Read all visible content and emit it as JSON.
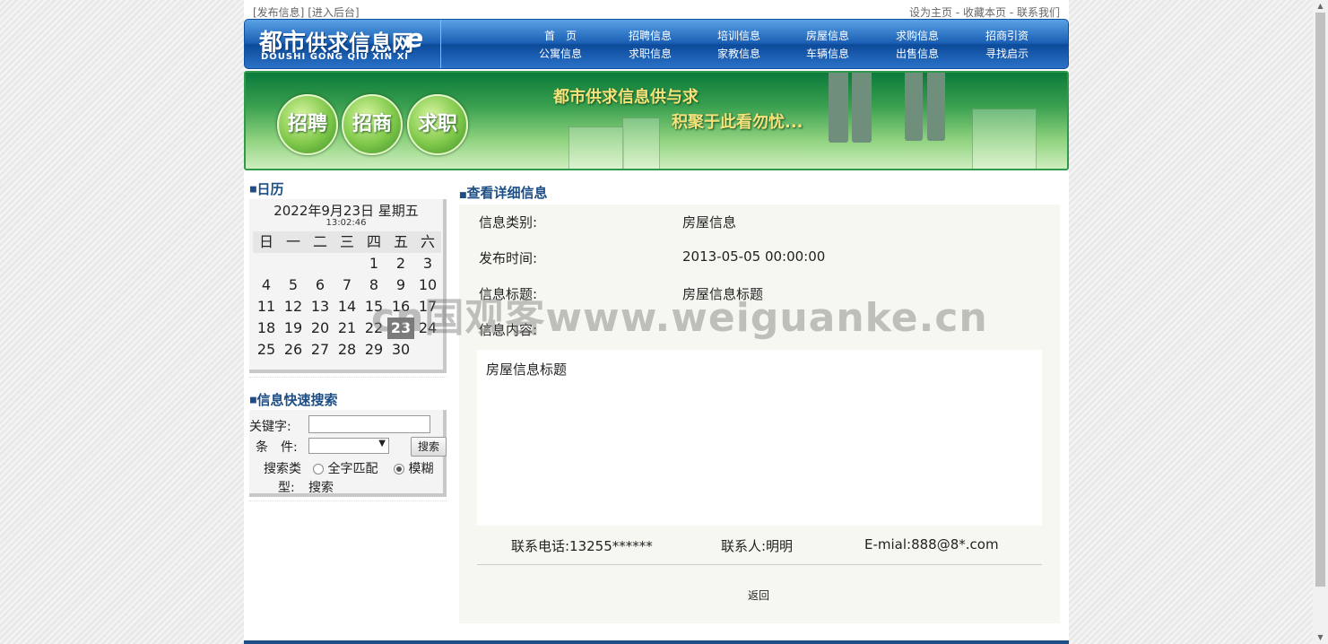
{
  "toplinks": {
    "publish": "[发布信息]",
    "admin": "[进入后台]",
    "sethome": "设为主页",
    "dash1": " - ",
    "bookmark": "收藏本页",
    "dash2": " - ",
    "contact": "联系我们"
  },
  "logo": {
    "cn_part1": "都市",
    "cn_part2": "供求信息网",
    "e": "e",
    "en": "DOUSHI  GONG QIU XIN XI"
  },
  "nav": {
    "row1": [
      "首　页",
      "招聘信息",
      "培训信息",
      "房屋信息",
      "求购信息",
      "招商引资"
    ],
    "row2": [
      "公寓信息",
      "求职信息",
      "家教信息",
      "车辆信息",
      "出售信息",
      "寻找启示"
    ]
  },
  "banner": {
    "buttons": [
      "招聘",
      "招商",
      "求职"
    ],
    "slogan1": "都市供求信息供与求",
    "slogan2": "积聚于此看勿忧..."
  },
  "sidebar": {
    "calendar_title": "日历",
    "date_line": "2022年9月23日 星期五",
    "time": "13:02:46",
    "weekdays": [
      "日",
      "一",
      "二",
      "三",
      "四",
      "五",
      "六"
    ],
    "weeks": [
      [
        "",
        "",
        "",
        "",
        "1",
        "2",
        "3"
      ],
      [
        "4",
        "5",
        "6",
        "7",
        "8",
        "9",
        "10"
      ],
      [
        "11",
        "12",
        "13",
        "14",
        "15",
        "16",
        "17"
      ],
      [
        "18",
        "19",
        "20",
        "21",
        "22",
        "23",
        "24"
      ],
      [
        "25",
        "26",
        "27",
        "28",
        "29",
        "30",
        ""
      ]
    ],
    "today": "23",
    "search_title": "信息快速搜索",
    "keyword_label": "关键字:",
    "condition_label": "条　件:",
    "search_button": "搜索",
    "search_type_label1": "搜索类",
    "search_type_label2": "型:",
    "option_exact": "全字匹配",
    "option_fuzzy1": "模糊",
    "option_fuzzy2": "搜索"
  },
  "main": {
    "title": "查看详细信息",
    "category_label": "信息类别:",
    "category_value": "房屋信息",
    "time_label": "发布时间:",
    "time_value": "2013-05-05 00:00:00",
    "subject_label": "信息标题:",
    "subject_value": "房屋信息标题",
    "content_label": "信息内容:",
    "content_value": "房屋信息标题",
    "phone": "联系电话:13255******",
    "person": "联系人:明明",
    "email": "E-mial:888@8*.com",
    "back": "返回"
  },
  "watermark": "cn国观客www.weiguanke.cn"
}
